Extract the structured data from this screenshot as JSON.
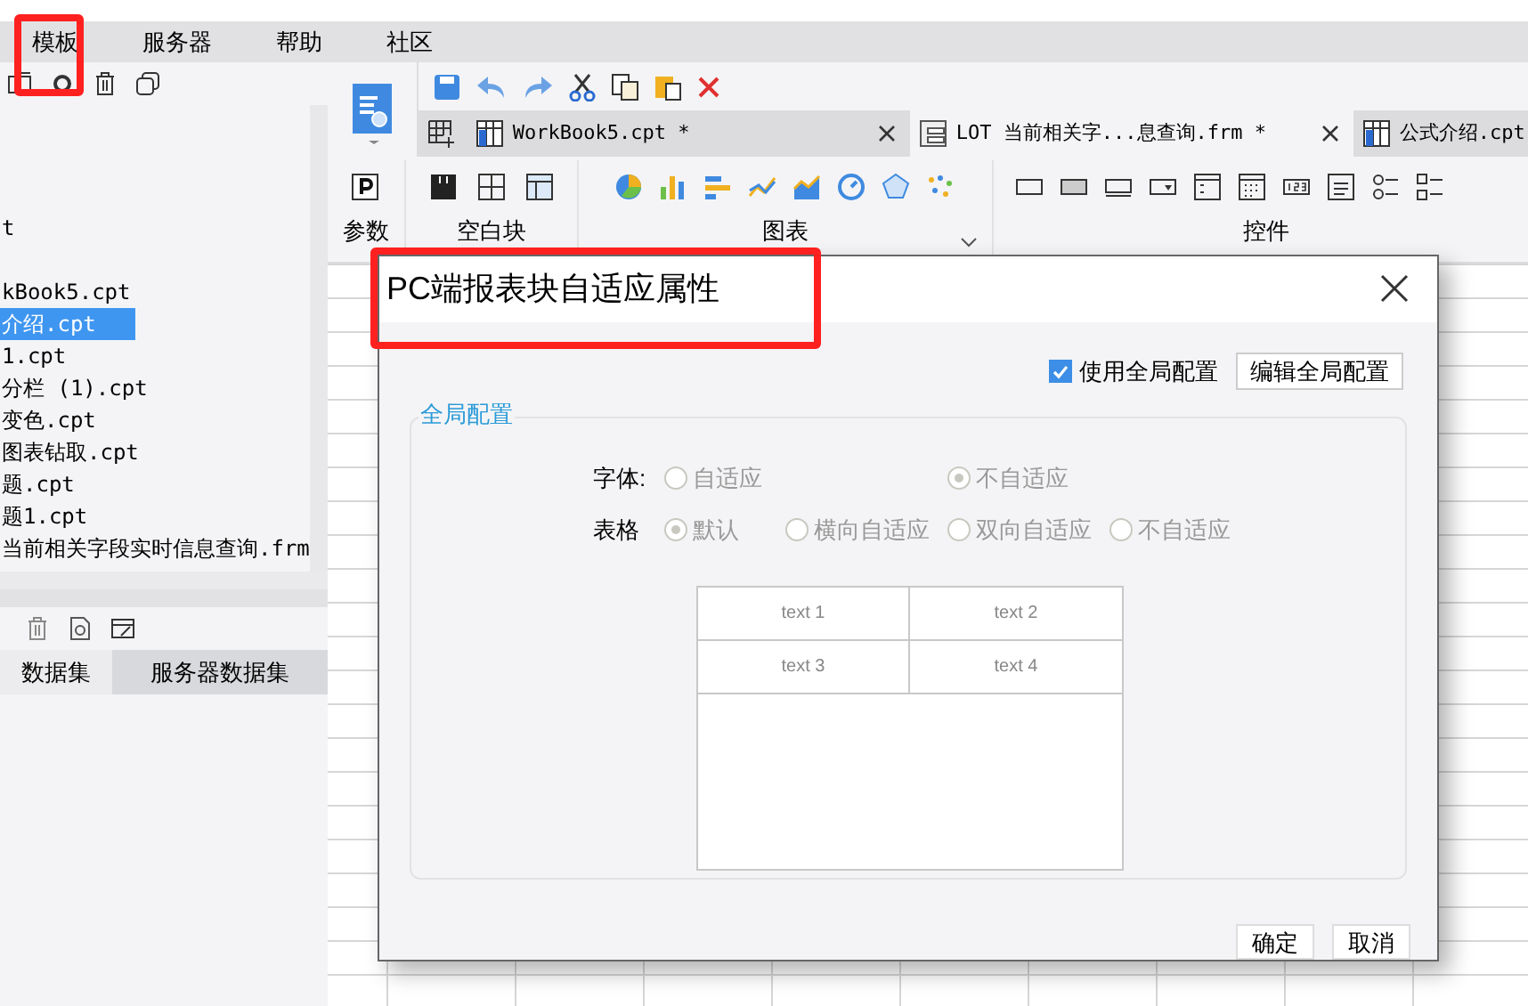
{
  "menu": [
    {
      "label": "模板",
      "highlighted": true
    },
    {
      "label": "服务器",
      "highlighted": false
    },
    {
      "label": "帮助",
      "highlighted": false
    },
    {
      "label": "社区",
      "highlighted": false
    }
  ],
  "tree": [
    {
      "label": "t",
      "selected": false
    },
    {
      "label": "kBook5.cpt",
      "selected": false
    },
    {
      "label": "介绍.cpt",
      "selected": true
    },
    {
      "label": "1.cpt",
      "selected": false
    },
    {
      "label": "分栏 (1).cpt",
      "selected": false
    },
    {
      "label": "变色.cpt",
      "selected": false
    },
    {
      "label": "图表钻取.cpt",
      "selected": false
    },
    {
      "label": "题.cpt",
      "selected": false
    },
    {
      "label": "题1.cpt",
      "selected": false
    },
    {
      "label": "当前相关字段实时信息查询.frm",
      "selected": false
    }
  ],
  "dataset_tabs": [
    {
      "label": "数据集",
      "selected": false
    },
    {
      "label": "服务器数据集",
      "selected": true
    }
  ],
  "doc_tabs": [
    {
      "label": "WorkBook5.cpt *",
      "selected": false,
      "kind": "cpt",
      "closable": true
    },
    {
      "label": "LOT 当前相关字...息查询.frm *",
      "selected": true,
      "kind": "frm",
      "closable": true
    },
    {
      "label": "公式介绍.cpt",
      "selected": false,
      "kind": "cpt",
      "closable": false
    }
  ],
  "ribbon_groups": [
    "参数",
    "空白块",
    "图表",
    "控件"
  ],
  "dialog": {
    "title": "PC端报表块自适应属性",
    "highlighted": true,
    "use_global": {
      "label": "使用全局配置",
      "checked": true
    },
    "edit_button": "编辑全局配置",
    "group_title": "全局配置",
    "rows": [
      {
        "label": "字体:",
        "kind": "font",
        "options": [
          {
            "label": "自适应",
            "selected": false
          },
          {
            "label": "不自适应",
            "selected": true
          }
        ]
      },
      {
        "label": "表格",
        "kind": "table",
        "options": [
          {
            "label": "默认",
            "selected": true
          },
          {
            "label": "横向自适应",
            "selected": false
          },
          {
            "label": "双向自适应",
            "selected": false
          },
          {
            "label": "不自适应",
            "selected": false
          }
        ]
      }
    ],
    "preview_cells": [
      "text 1",
      "text 2",
      "text 3",
      "text 4"
    ],
    "buttons": [
      "确定",
      "取消"
    ]
  }
}
